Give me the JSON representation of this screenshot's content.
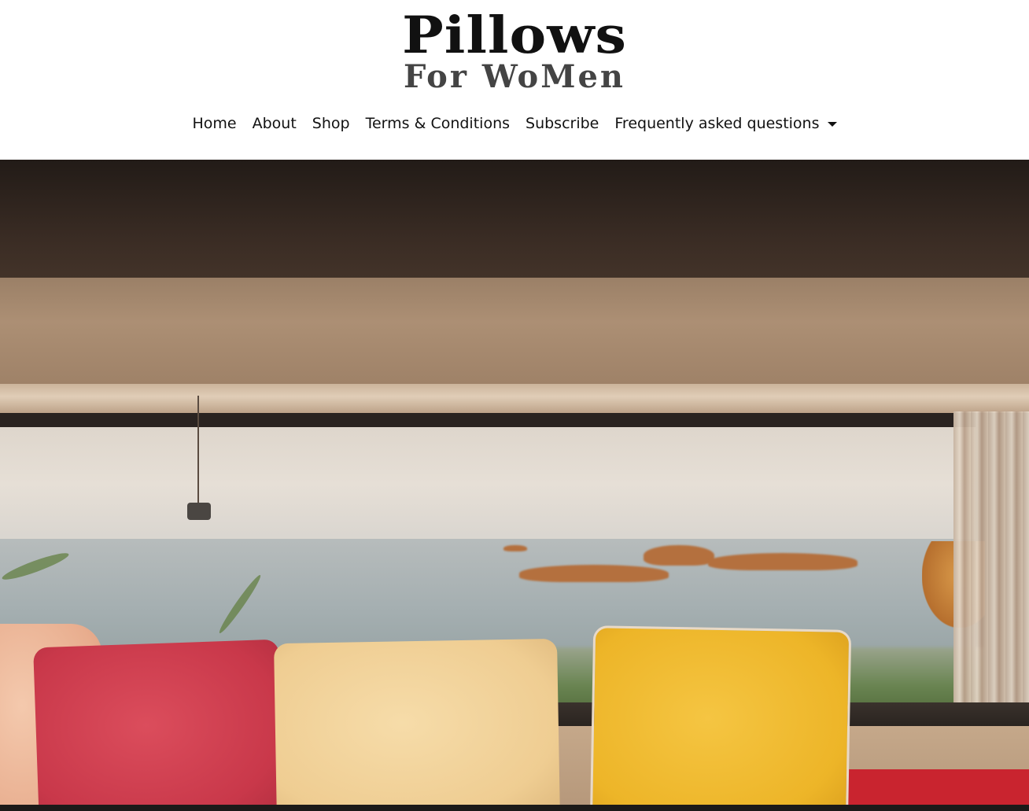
{
  "logo": {
    "line1": "Pillows",
    "line2": "For WoMen"
  },
  "nav": {
    "items": [
      {
        "label": "Home"
      },
      {
        "label": "About"
      },
      {
        "label": "Shop"
      },
      {
        "label": "Terms & Conditions"
      },
      {
        "label": "Subscribe"
      },
      {
        "label": "Frequently asked questions",
        "dropdown": true
      }
    ]
  },
  "hero": {
    "icon": "hero-image"
  },
  "colors": {
    "text": "#111111",
    "background": "#ffffff"
  }
}
